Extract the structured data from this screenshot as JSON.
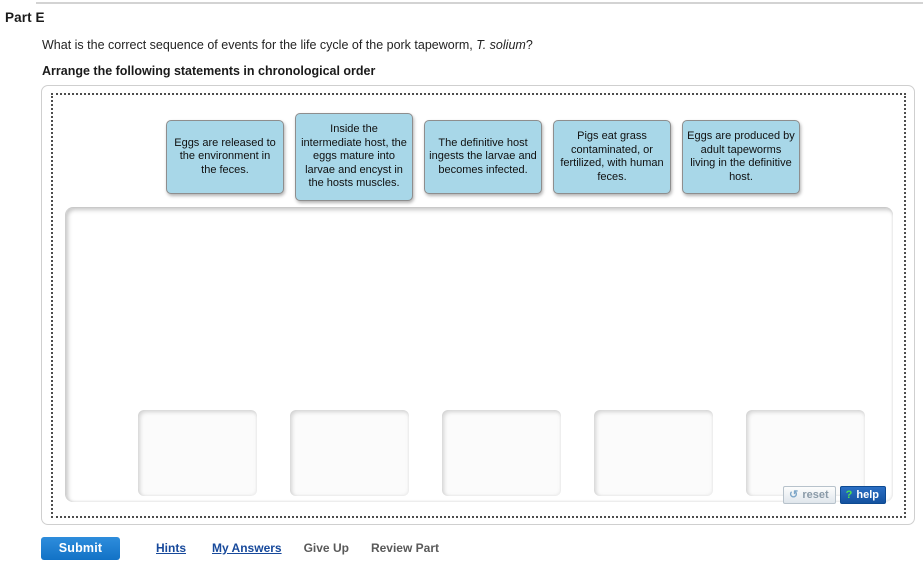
{
  "part": {
    "title": "Part E",
    "question_prefix": "What is the correct sequence of events for the life cycle of the pork tapeworm, ",
    "question_italic": "T. solium",
    "question_suffix": "?",
    "instruction": "Arrange the following statements in chronological order"
  },
  "tiles": [
    {
      "id": "tile-1",
      "text": "Eggs are released to the environment in the feces."
    },
    {
      "id": "tile-2",
      "text": "Inside the intermediate host, the eggs mature into larvae and encyst in the hosts muscles."
    },
    {
      "id": "tile-3",
      "text": "The definitive host ingests the larvae and becomes infected."
    },
    {
      "id": "tile-4",
      "text": "Pigs eat grass contaminated, or fertilized, with human feces."
    },
    {
      "id": "tile-5",
      "text": "Eggs are produced by adult tapeworms living in the definitive host."
    }
  ],
  "slots": [
    {
      "id": "slot-1",
      "content": ""
    },
    {
      "id": "slot-2",
      "content": ""
    },
    {
      "id": "slot-3",
      "content": ""
    },
    {
      "id": "slot-4",
      "content": ""
    },
    {
      "id": "slot-5",
      "content": ""
    }
  ],
  "tools": {
    "reset_label": "reset",
    "reset_icon": "reset-circular-arrow-icon",
    "reset_glyph": "↻",
    "help_label": "help",
    "help_icon": "question-mark-icon",
    "help_glyph": "?"
  },
  "footer": {
    "submit_label": "Submit",
    "hints_label": "Hints",
    "my_answers_label": "My Answers",
    "give_up_label": "Give Up",
    "review_part_label": "Review Part"
  },
  "colors": {
    "tile_fill": "#a8d7e8",
    "tile_border": "#8e8e8e",
    "submit_blue": "#1272c6",
    "link_blue": "#17499b",
    "help_blue": "#14529f",
    "help_question_green": "#4ee44e",
    "panel_border": "#cfcfcf",
    "dotted_border": "#4d4d4d"
  }
}
